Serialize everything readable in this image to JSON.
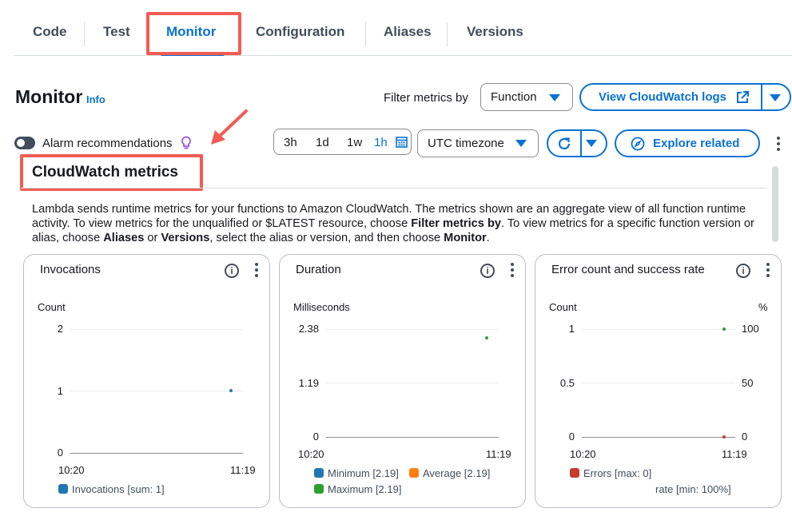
{
  "tabs": [
    {
      "label": "Code",
      "active": false
    },
    {
      "label": "Test",
      "active": false
    },
    {
      "label": "Monitor",
      "active": true
    },
    {
      "label": "Configuration",
      "active": false
    },
    {
      "label": "Aliases",
      "active": false
    },
    {
      "label": "Versions",
      "active": false
    }
  ],
  "header": {
    "title": "Monitor",
    "info": "Info",
    "filter_label": "Filter metrics by",
    "filter_value": "Function",
    "view_logs": "View CloudWatch logs"
  },
  "toolbar": {
    "alarm_label": "Alarm recommendations",
    "ranges": [
      "3h",
      "1d",
      "1w",
      "1h"
    ],
    "active_range": "1h",
    "timezone": "UTC timezone",
    "explore": "Explore related"
  },
  "cloudwatch": {
    "title": "CloudWatch metrics",
    "desc_1": "Lambda sends runtime metrics for your functions to Amazon CloudWatch. The metrics shown are an aggregate view of all function runtime activity. To view metrics for the unqualified or $LATEST resource, choose ",
    "desc_b1": "Filter metrics by",
    "desc_2": ". To view metrics for a specific function version or alias, choose ",
    "desc_b2": "Aliases",
    "desc_3": " or ",
    "desc_b3": "Versions",
    "desc_4": ", select the alias or version, and then choose ",
    "desc_b4": "Monitor",
    "desc_5": "."
  },
  "colors": {
    "accent": "#0972d3",
    "annotation": "#f25c54",
    "series_blue": "#1f77b4",
    "series_orange": "#ff7f0e",
    "series_green": "#2ca02c",
    "series_red": "#c33d2b"
  },
  "chart_data": [
    {
      "type": "scatter",
      "title": "Invocations",
      "ylabel": "Count",
      "y_ticks": [
        "2",
        "1",
        "0"
      ],
      "x_ticks": [
        "10:20",
        "11:19"
      ],
      "ylim": [
        0,
        2
      ],
      "series": [
        {
          "name": "Invocations [sum: 1]",
          "points": [
            {
              "x": "11:19",
              "y": 1
            }
          ]
        }
      ]
    },
    {
      "type": "scatter",
      "title": "Duration",
      "ylabel": "Milliseconds",
      "y_ticks": [
        "2.38",
        "1.19",
        "0"
      ],
      "x_ticks": [
        "10:20",
        "11:19"
      ],
      "ylim": [
        0,
        2.38
      ],
      "series": [
        {
          "name": "Minimum [2.19]",
          "points": [
            {
              "x": "11:19",
              "y": 2.19
            }
          ]
        },
        {
          "name": "Average [2.19]",
          "points": [
            {
              "x": "11:19",
              "y": 2.19
            }
          ]
        },
        {
          "name": "Maximum [2.19]",
          "points": [
            {
              "x": "11:19",
              "y": 2.19
            }
          ]
        }
      ]
    },
    {
      "type": "scatter",
      "title": "Error count and success rate",
      "ylabel": "Count",
      "y2label": "%",
      "y_ticks": [
        "1",
        "0.5",
        "0"
      ],
      "y2_ticks": [
        "100",
        "50",
        "0"
      ],
      "x_ticks": [
        "10:20",
        "11:19"
      ],
      "ylim": [
        0,
        1
      ],
      "y2lim": [
        0,
        100
      ],
      "series": [
        {
          "name": "Errors [max: 0]",
          "points": [
            {
              "x": "11:19",
              "y": 0
            }
          ]
        },
        {
          "name": "rate [min: 100%]",
          "points": [
            {
              "x": "11:19",
              "y": 100
            }
          ]
        }
      ]
    }
  ]
}
